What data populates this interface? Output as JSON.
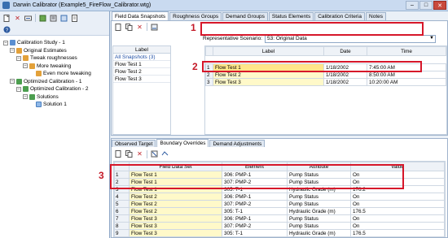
{
  "window": {
    "title": "Darwin Calibrator (Example5_FireFlow_Calibrator.wtg)",
    "buttons": [
      "–",
      "□",
      "✕"
    ]
  },
  "left_toolbar": {
    "row1": [
      "new-icon",
      "delete-icon",
      "rename-icon"
    ],
    "row2": [
      "help-icon"
    ]
  },
  "tree": [
    {
      "label": "Calibration Study - 1",
      "level": 0,
      "toggle": "–",
      "icon": "study-icon"
    },
    {
      "label": "Original Estimates",
      "level": 1,
      "toggle": "–",
      "icon": "estimates-icon"
    },
    {
      "label": "Tweak roughnesses",
      "level": 2,
      "toggle": "–",
      "icon": "estimates-icon"
    },
    {
      "label": "More tweaking",
      "level": 3,
      "toggle": "–",
      "icon": "estimates-icon"
    },
    {
      "label": "Even more tweaking",
      "level": 4,
      "toggle": "",
      "icon": "estimates-icon"
    },
    {
      "label": "Optimized Calibration - 1",
      "level": 1,
      "toggle": "–",
      "icon": "optimized-icon"
    },
    {
      "label": "Optimized Calibration - 2",
      "level": 2,
      "toggle": "–",
      "icon": "optimized-icon"
    },
    {
      "label": "Solutions",
      "level": 3,
      "toggle": "–",
      "icon": "solutions-icon"
    },
    {
      "label": "Solution 1",
      "level": 4,
      "toggle": "",
      "icon": "solution-icon"
    }
  ],
  "tabs": [
    "Field Data Snapshots",
    "Roughness Groups",
    "Demand Groups",
    "Status Elements",
    "Calibration Criteria",
    "Notes"
  ],
  "scenario": {
    "label": "Representative Scenario:",
    "value": "53: Original Data"
  },
  "snapshot_labels": {
    "header": "Label",
    "items": [
      "All Snapshots (3)",
      "Flow Test 1",
      "Flow Test 2",
      "Flow Test 3"
    ]
  },
  "snapshot_grid": {
    "columns": [
      "",
      "Label",
      "Date",
      "Time"
    ],
    "rows": [
      [
        "1",
        "Flow Test 1",
        "1/18/2002",
        "7:45:00 AM"
      ],
      [
        "2",
        "Flow Test 2",
        "1/18/2002",
        "8:50:00 AM"
      ],
      [
        "3",
        "Flow Test 3",
        "1/18/2002",
        "10:20:00 AM"
      ]
    ]
  },
  "subtabs": [
    "Observed Target",
    "Boundary Overrides",
    "Demand Adjustments"
  ],
  "overrides_grid": {
    "columns": [
      "",
      "Field Data Set",
      "Element",
      "Attribute",
      "Value"
    ],
    "rows": [
      [
        "1",
        "Flow Test 1",
        "306: PMP-1",
        "Pump Status",
        "On"
      ],
      [
        "2",
        "Flow Test 1",
        "307: PMP-2",
        "Pump Status",
        "On"
      ],
      [
        "3",
        "Flow Test 1",
        "305: T-1",
        "Hydraulic Grade (m)",
        "176.2"
      ],
      [
        "4",
        "Flow Test 2",
        "306: PMP-1",
        "Pump Status",
        "On"
      ],
      [
        "5",
        "Flow Test 2",
        "307: PMP-2",
        "Pump Status",
        "On"
      ],
      [
        "6",
        "Flow Test 2",
        "305: T-1",
        "Hydraulic Grade (m)",
        "176.5"
      ],
      [
        "7",
        "Flow Test 3",
        "306: PMP-1",
        "Pump Status",
        "On"
      ],
      [
        "8",
        "Flow Test 3",
        "307: PMP-2",
        "Pump Status",
        "On"
      ],
      [
        "9",
        "Flow Test 3",
        "305: T-1",
        "Hydraulic Grade (m)",
        "176.5"
      ]
    ]
  },
  "annotations": [
    "1",
    "2",
    "3"
  ],
  "colors": {
    "highlight": "#d6172a",
    "selected_cell": "#ffe68a",
    "cell_yellow": "#fff9c9"
  }
}
